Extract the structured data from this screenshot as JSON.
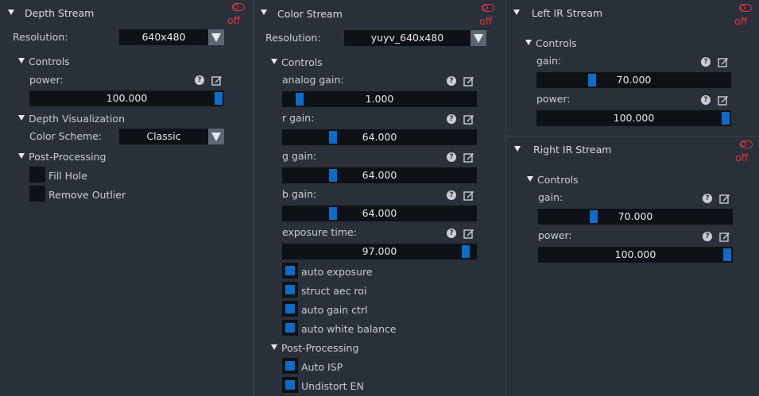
{
  "depth": {
    "title": "Depth Stream",
    "toggle_state": "off",
    "resolution_label": "Resolution:",
    "resolution_value": "640x480",
    "controls_label": "Controls",
    "power_label": "power:",
    "power_value": "100.000",
    "power_fraction": 1.0,
    "visualization_label": "Depth Visualization",
    "color_scheme_label": "Color Scheme:",
    "color_scheme_value": "Classic",
    "postproc_label": "Post-Processing",
    "fill_hole_label": "Fill Hole",
    "fill_hole_checked": false,
    "remove_outlier_label": "Remove Outlier",
    "remove_outlier_checked": false
  },
  "color": {
    "title": "Color Stream",
    "toggle_state": "off",
    "resolution_label": "Resolution:",
    "resolution_value": "yuyv_640x480",
    "controls_label": "Controls",
    "analog_gain_label": "analog gain:",
    "analog_gain_value": "1.000",
    "r_gain_label": "r gain:",
    "r_gain_value": "64.000",
    "g_gain_label": "g gain:",
    "g_gain_value": "64.000",
    "b_gain_label": "b gain:",
    "b_gain_value": "64.000",
    "exposure_label": "exposure time:",
    "exposure_value": "97.000",
    "auto_exposure_label": "auto exposure",
    "struct_aec_label": "struct aec roi",
    "auto_gain_label": "auto gain ctrl",
    "auto_wb_label": "auto white balance",
    "postproc_label": "Post-Processing",
    "auto_isp_label": "Auto ISP",
    "undistort_label": "Undistort EN"
  },
  "left_ir": {
    "title": "Left IR Stream",
    "toggle_state": "off",
    "controls_label": "Controls",
    "gain_label": "gain:",
    "gain_value": "70.000",
    "power_label": "power:",
    "power_value": "100.000"
  },
  "right_ir": {
    "title": "Right IR Stream",
    "toggle_state": "off",
    "controls_label": "Controls",
    "gain_label": "gain:",
    "gain_value": "70.000",
    "power_label": "power:",
    "power_value": "100.000"
  },
  "icons": {
    "help": "?",
    "edit": "edit-icon",
    "collapse": "triangle-down-icon",
    "toggle": "toggle-icon"
  },
  "colors": {
    "accent": "#0c6cc7",
    "off_red": "#e0343a",
    "panel_bg": "#29303a",
    "field_bg": "#0e1216"
  }
}
